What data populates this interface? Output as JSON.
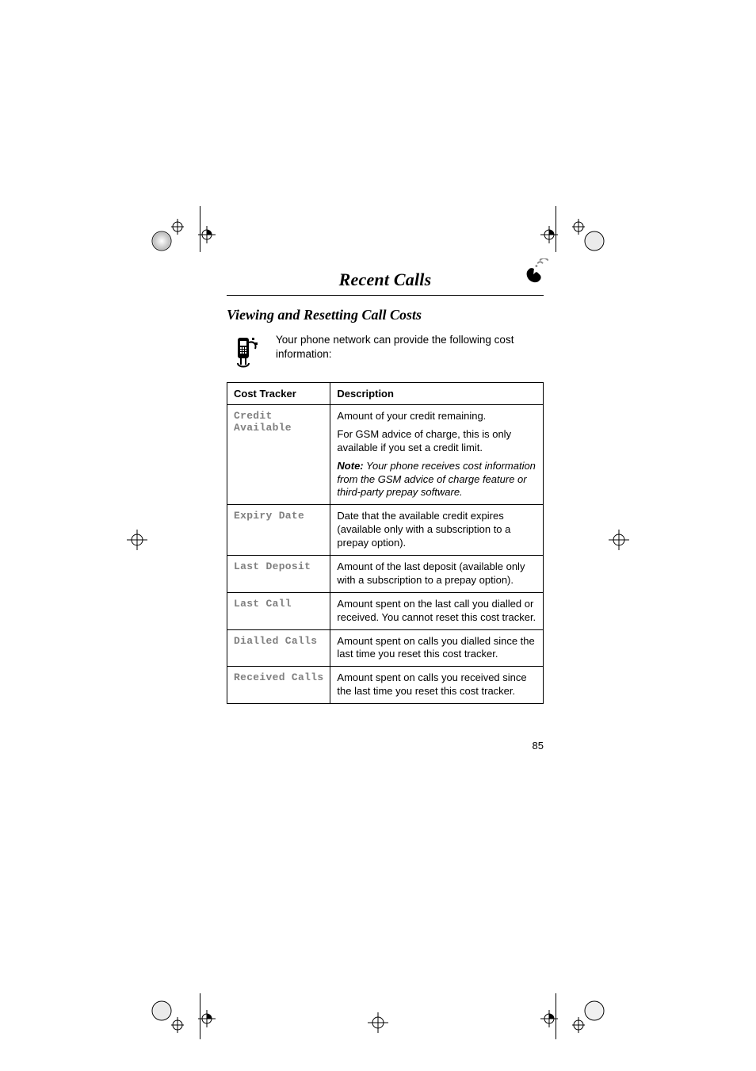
{
  "chapter_title": "Recent Calls",
  "section_title": "Viewing and Resetting Call Costs",
  "intro_text": "Your phone network can provide the following cost information:",
  "page_number": "85",
  "table": {
    "header_tracker": "Cost Tracker",
    "header_description": "Description",
    "rows": [
      {
        "tracker": "Credit Available",
        "desc": [
          {
            "text": "Amount of your credit remaining."
          },
          {
            "text": "For GSM advice of charge, this is only available if you set a credit limit."
          },
          {
            "note_lead": "Note:",
            "note_body": " Your phone receives cost information from the GSM advice of charge feature or third-party prepay software."
          }
        ]
      },
      {
        "tracker": "Expiry Date",
        "desc": [
          {
            "text": "Date that the available credit expires (available only with a subscription to a prepay option)."
          }
        ]
      },
      {
        "tracker": "Last Deposit",
        "desc": [
          {
            "text": "Amount of the last deposit (available only with a subscription to a prepay option)."
          }
        ]
      },
      {
        "tracker": "Last Call",
        "desc": [
          {
            "text": "Amount spent on the last call you dialled or received. You cannot reset this cost tracker."
          }
        ]
      },
      {
        "tracker": "Dialled Calls",
        "desc": [
          {
            "text": "Amount spent on calls you dialled since the last time you reset this cost tracker."
          }
        ]
      },
      {
        "tracker": "Received Calls",
        "desc": [
          {
            "text": "Amount spent on calls you received since the last time you reset this cost tracker."
          }
        ]
      }
    ]
  },
  "icons": {
    "chapter_icon": "phone-motion-icon",
    "intro_icon": "phone-network-icon"
  }
}
